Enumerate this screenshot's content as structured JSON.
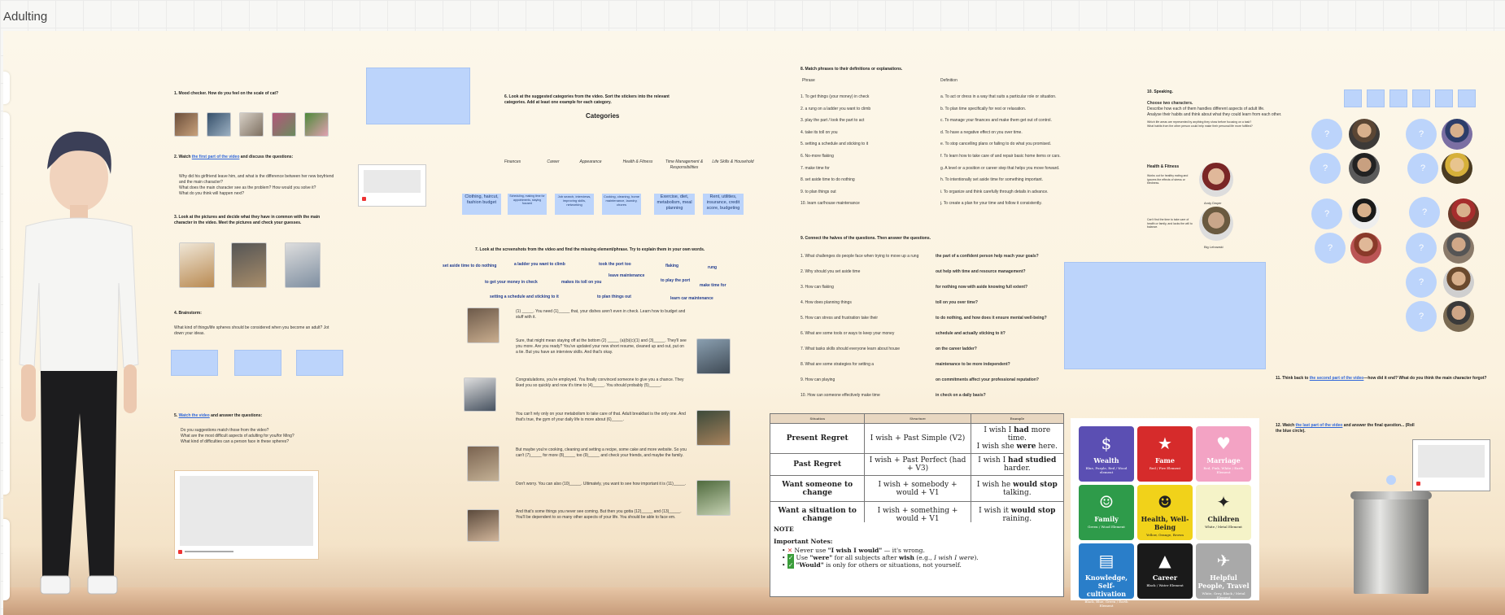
{
  "board": {
    "title": "Adulting"
  },
  "sec1": {
    "title": "1. Mood checker. How do you feel on the scale of cat?"
  },
  "sec2": {
    "title_pre": "2. Watch ",
    "title_link": "the first part of the video",
    "title_post": " and discuss the questions:",
    "q1": "Why did his girlfriend leave him, and what is the difference between her new boyfriend and the main character?",
    "q2": "What does the main character see as the problem? How would you solve it?",
    "q3": "What do you think will happen next?"
  },
  "sec3": {
    "title": "3. Look at the pictures and decide what they have in common with the main character in the video. Meet the pictures and check your guesses."
  },
  "sec4": {
    "title": "4. Brainstorm:",
    "q": "What kind of things/life spheres should be considered when you become an adult? Jot down your ideas."
  },
  "sec5": {
    "title_link": "Watch the video",
    "title_post": " and answer the questions:",
    "q1": "Do you suggestions match those from the video?",
    "q2": "What are the most difficult aspects of adulting for you/for Ming?",
    "q3": "What kind of difficulties can a person face in these spheres?"
  },
  "sec6": {
    "title": "6. Look at the suggested categories from the video. Sort the stickers into the relevant categories. Add at least one example for each category.",
    "heading": "Categories",
    "categories": [
      "Finances",
      "Career",
      "Appearance",
      "Health & Fitness",
      "Time Management & Responsibilities",
      "Life Skills & Household"
    ],
    "stickers": [
      "Clothing, haircut, fashion budget",
      "Scheduling, making time for appointments, staying focused",
      "Job search, interviews, improving skills, networking",
      "Cooking, cleaning, home maintenance, laundry, chores",
      "Exercise, diet, metabolism, meal planning",
      "Rent, utilities, insurance, credit score, budgeting"
    ]
  },
  "sec7": {
    "title": "7. Look at the screenshots from the video and find the missing element/phrase. Try to explain them in your own words.",
    "fragments": [
      "set aside time to do nothing",
      "a ladder you want to climb",
      "took the port too",
      "flaking",
      "rung",
      "leave maintenance",
      "to get your money in check",
      "makes its toll on you",
      "to play the port",
      "make time for",
      "setting a schedule and sticking to it",
      "to plan things out",
      "learn car maintenance"
    ],
    "texts": [
      "(1) _____. You need (1)_____ that, your dishes aren't even in check. Learn how to budget and stuff with it.",
      "Sure, that might mean staying off at the bottom (2) _____ (a)(b)(c)(1) and (3)_____. They'll see you more. Are you ready? You've updated your new short resume, cleaned up and out, put on a tie. But you have an interview skills. And that's okay.",
      "Congratulations, you're employed. You finally convinced someone to give you a chance. They liked you so quickly and now it's time to (4)_____. You should probably (5)_____.",
      "You can't rely only on your metabolism to take care of that. Adult breakfast is the only one. And that's true, the gym of your daily life is more about (6)_____.",
      "But maybe you're cooking, cleaning and setting a recipe, some cake and more website. So you can't (7)_____ for more (8)_____ too (9)_____ and check your friends, and maybe the family.",
      "Don't worry. You can also (10)_____. Ultimately, you want to see how important it is (11)_____.",
      "And that's some things you never see coming. But then you gotta (12)_____ and (13)_____. You'll be dependent to so many other aspects of your life. You should be able to face em."
    ]
  },
  "sec8": {
    "title": "8. Match phrases to their definitions or explanations.",
    "col_a": "Phrase",
    "col_b": "Definition",
    "phrases": [
      "1. To get things (your money) in check",
      "2. a rung on a ladder you want to climb",
      "3. play the part / look the part to act",
      "4. take its toll on you",
      "5. setting a schedule and sticking to it",
      "6. No-more flaking",
      "7. make time for",
      "8. set aside time to do nothing",
      "9. to plan things out",
      "10. learn car/house maintenance"
    ],
    "defs": [
      "a. To act or dress in a way that suits a particular role or situation.",
      "b. To plan time specifically for rest or relaxation.",
      "c. To manage your finances and make them get out of control.",
      "d. To have a negative effect on you over time.",
      "e. To stop cancelling plans or failing to do what you promised.",
      "f. To learn how to take care of and repair basic home items or cars.",
      "g. A level or a position or career step that helps you move forward.",
      "h. To intentionally set aside time for something important.",
      "i. To organize and think carefully through details in advance.",
      "j. To create a plan for your time and follow it consistently."
    ]
  },
  "sec9": {
    "title": "9. Connect the halves of the questions. Then answer the questions.",
    "left": [
      "1. What challenges do people face when trying to move up a rung",
      "2. Why should you set aside time",
      "3. How can flaking",
      "4. How does planning things",
      "5. How can stress and frustration take their",
      "6. What are some tools or ways to keep your money",
      "7. What tasks skills should everyone learn about house",
      "8. What are some strategies for setting a",
      "9. How can playing",
      "10. How can someone effectively make time"
    ],
    "right": [
      "the part of a confident person help reach your goals?",
      "out help with time and resource management?",
      "for nothing now with aside knowing full extent?",
      "toll on you over time?",
      "to do nothing, and how does it ensure mental well-being?",
      "schedule and actually sticking to it?",
      "on the career ladder?",
      "maintenance to be more independent?",
      "on commitments affect your professional reputation?",
      "in check on a daily basis?"
    ]
  },
  "sec10": {
    "title": "10. Speaking.",
    "choose": "Choose two characters.",
    "describe": "Describe how each of them handles different aspects of adult life.",
    "analyse": "Analyse their habits and think about what they could learn from each other.",
    "b1": "Which life areas are represented by anything they show before focusing on a task?",
    "b2": "What habits from the other person could help make their personal life more fulfilled?",
    "p1_title": "Health & Fitness",
    "p1_text": "Works out for healthy eating and ignores the effects of stress or tiredness.",
    "p1_name": "Andy Dwyer",
    "p2_text": "Can't find the time to take care of health or family, and lacks the will to balance.",
    "p2_name": "Big Lebowski"
  },
  "sec11": {
    "pre": "11. Think back to ",
    "link": "the second part of the video",
    "post": "—how did it end? What do you think the main character forgot?"
  },
  "sec12": {
    "pre": "12. Watch ",
    "link": "the last part of the video",
    "post": " and answer the final question... (Roll the blue circle)."
  },
  "circles": {
    "label": "?"
  },
  "grammar": {
    "headers": [
      "Situation",
      "Structure",
      "Example"
    ],
    "rows": [
      {
        "situation": "Present Regret",
        "structure": "I wish + Past Simple (V2)",
        "ex1": "I wish I ",
        "exb": "had",
        "ex2": " more time.",
        "ex3": "I wish she ",
        "exb2": "were",
        "ex4": " here."
      },
      {
        "situation": "Past Regret",
        "structure": "I wish + Past Perfect (had + V3)",
        "ex1": "I wish I ",
        "exb": "had studied",
        "ex2": " harder."
      },
      {
        "situation": "Want someone to change",
        "structure": "I wish + somebody + would + V1",
        "ex1": "I wish he ",
        "exb": "would stop",
        "ex2": " talking."
      },
      {
        "situation": "Want a situation to change",
        "structure": "I wish + something + would + V1",
        "ex1": "I wish it ",
        "exb": "would stop",
        "ex2": " raining."
      }
    ],
    "note": "NOTE",
    "important": "Important Notes:",
    "n1a": "Never use ",
    "n1b": "\"I wish I would\"",
    "n1c": " — it's wrong.",
    "n2a": "Use ",
    "n2b": "\"were\"",
    "n2c": " for all subjects after ",
    "n2d": "wish",
    "n2e": " (e.g., ",
    "n2f": "I wish I were",
    "n2g": ").",
    "n3a": "\"Would\"",
    "n3b": " is only for others or situations, not yourself."
  },
  "tiles": [
    {
      "name": "Wealth",
      "sub": "Blue, Purple, Red / Wood element",
      "icon": "$",
      "color": "#5b4fb3"
    },
    {
      "name": "Fame",
      "sub": "Red / Fire Element",
      "icon": "★",
      "color": "#d62b2b"
    },
    {
      "name": "Marriage",
      "sub": "Red, Pink, White / Earth Element",
      "icon": "♥",
      "color": "#f3a3c4"
    },
    {
      "name": "Family",
      "sub": "Green / Wood Element",
      "icon": "☺",
      "color": "#2e9b4a"
    },
    {
      "name": "Health, Well-Being",
      "sub": "Yellow, Orange, Brown",
      "icon": "☻",
      "color": "#f1d21a"
    },
    {
      "name": "Children",
      "sub": "White / Metal Element",
      "icon": "✦",
      "color": "#f5f3c8"
    },
    {
      "name": "Knowledge, Self-cultivation",
      "sub": "Black, Blue, Green / Earth Element",
      "icon": "▤",
      "color": "#2a7ec9"
    },
    {
      "name": "Career",
      "sub": "Black / Water Element",
      "icon": "▲",
      "color": "#1a1a1a"
    },
    {
      "name": "Helpful People, Travel",
      "sub": "White, Grey, Black / Metal Element",
      "icon": "✈",
      "color": "#a9a9a9"
    }
  ],
  "colors": {
    "sticky": "#bcd4fb",
    "link": "#2f66d9"
  }
}
